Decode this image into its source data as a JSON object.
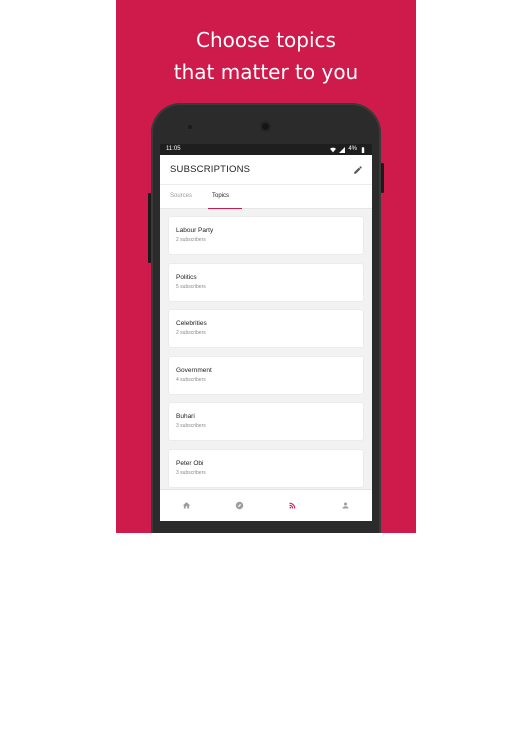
{
  "promo": {
    "headline_line1": "Choose topics",
    "headline_line2": "that matter to you"
  },
  "status_bar": {
    "time": "11:05",
    "battery": "4%",
    "icons": [
      "wifi-icon",
      "signal-icon",
      "battery-icon"
    ]
  },
  "app_bar": {
    "title": "SUBSCRIPTIONS",
    "action_icon": "pencil-icon"
  },
  "tabs": [
    {
      "label": "Sources",
      "active": false
    },
    {
      "label": "Topics",
      "active": true
    }
  ],
  "topics": [
    {
      "name": "Labour Party",
      "subscribers": "2 subscribers"
    },
    {
      "name": "Politics",
      "subscribers": "5 subscribers"
    },
    {
      "name": "Celebrities",
      "subscribers": "2 subscribers"
    },
    {
      "name": "Government",
      "subscribers": "4 subscribers"
    },
    {
      "name": "Buhari",
      "subscribers": "3 subscribers"
    },
    {
      "name": "Peter Obi",
      "subscribers": "3 subscribers"
    }
  ],
  "bottom_nav": [
    {
      "icon": "home-icon",
      "active": false
    },
    {
      "icon": "compass-icon",
      "active": false
    },
    {
      "icon": "rss-feed-icon",
      "active": true
    },
    {
      "icon": "person-icon",
      "active": false
    }
  ],
  "colors": {
    "brand": "#cf1a4c",
    "inactive_icon": "#9e9e9e"
  }
}
